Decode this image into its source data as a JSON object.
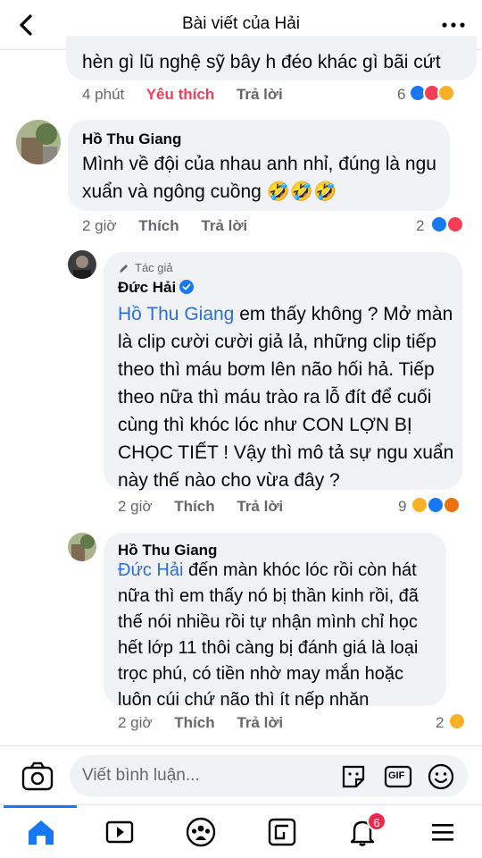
{
  "header": {
    "title": "Bài viết của Hải"
  },
  "comments": [
    {
      "text": "hèn gì lũ nghệ sỹ bây h đéo khác gì bãi cứt",
      "time": "4 phút",
      "like_label": "Yêu thích",
      "reply_label": "Trả lời",
      "reaction_count": "6",
      "reactions": [
        "like",
        "love",
        "haha"
      ]
    },
    {
      "name": "Hồ Thu Giang",
      "text": "Mình về đội của nhau anh nhỉ, đúng là ngu xuẩn và ngông cuồng 🤣🤣🤣",
      "time": "2 giờ",
      "like_label": "Thích",
      "reply_label": "Trả lời",
      "reaction_count": "2",
      "reactions": [
        "like",
        "love"
      ]
    },
    {
      "author_badge": "Tác giả",
      "name": "Đức Hải",
      "mention": "Hồ Thu Giang",
      "text": "em thấy không ? Mở màn là clip cười cười giả lả, những clip tiếp theo thì máu bơm lên não hối hả. Tiếp theo nữa thì máu trào ra lỗ đít để cuối cùng thì khóc lóc như CON LỢN BỊ CHỌC TIẾT ! Vậy thì mô tả sự ngu xuẩn này thế nào cho vừa đây ?",
      "time": "2 giờ",
      "like_label": "Thích",
      "reply_label": "Trả lời",
      "reaction_count": "9",
      "reactions": [
        "haha",
        "like",
        "angry"
      ]
    },
    {
      "name": "Hồ Thu Giang",
      "mention": "Đức Hải",
      "text": "đến màn khóc lóc rồi còn hát nữa thì em thấy nó bị thần kinh rồi, đã thế nói nhiều rồi tự nhận mình chỉ học hết lớp 11 thôi càng bị đánh giá là loại trọc phú, có tiền nhờ may mắn hoặc luôn cúi chứ não thì ít nếp nhăn",
      "time": "2 giờ",
      "like_label": "Thích",
      "reply_label": "Trả lời",
      "reaction_count": "2",
      "reactions": [
        "haha"
      ]
    }
  ],
  "composer": {
    "placeholder": "Viết bình luận...",
    "gif_label": "GIF"
  },
  "tabbar": {
    "notification_count": "6"
  },
  "colors": {
    "accent": "#1877f2",
    "love": "#f33e58",
    "bubble": "#f0f2f5",
    "meta": "#65676b"
  }
}
